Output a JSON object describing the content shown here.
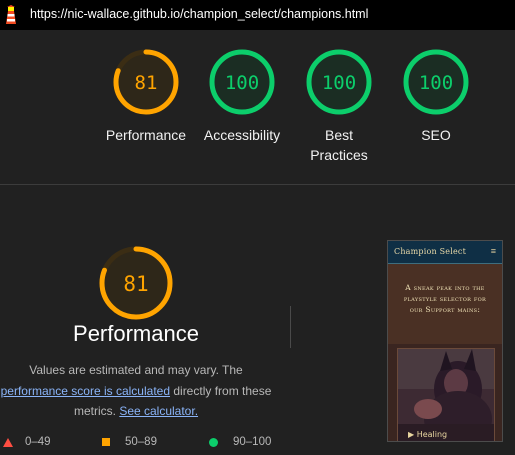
{
  "browser": {
    "url": "https://nic-wallace.github.io/champion_select/champions.html",
    "logo_icon": "lighthouse-icon"
  },
  "summary": {
    "gauges": [
      {
        "label": "Performance",
        "score": "81",
        "value": 81,
        "color": "#ffa400",
        "track": "#3b2d14",
        "text_color": "#ffa400"
      },
      {
        "label": "Accessibility",
        "score": "100",
        "value": 100,
        "color": "#0cce6b",
        "track": "#173826",
        "text_color": "#0cce6b"
      },
      {
        "label": "Best Practices",
        "score": "100",
        "value": 100,
        "color": "#0cce6b",
        "track": "#173826",
        "text_color": "#0cce6b"
      },
      {
        "label": "SEO",
        "score": "100",
        "value": 100,
        "color": "#0cce6b",
        "track": "#173826",
        "text_color": "#0cce6b"
      }
    ]
  },
  "performance": {
    "score": "81",
    "value": 81,
    "title": "Performance",
    "desc_line1": "Values are estimated and may vary. The",
    "desc_link": "performance score is calculated",
    "desc_line2_after": " directly from these",
    "desc_line3_before": "metrics. ",
    "calc_link": "See calculator.",
    "colors": {
      "average": "#ffa400",
      "pass": "#0cce6b",
      "fail": "#ff4e42"
    }
  },
  "legend": [
    {
      "range": "0–49",
      "icon": "fail-triangle-icon"
    },
    {
      "range": "50–89",
      "icon": "average-square-icon"
    },
    {
      "range": "90–100",
      "icon": "pass-circle-icon"
    }
  ],
  "screenshot": {
    "title": "Champion Select",
    "caption": "A sneak peak into the playstyle selector for our Support mains:",
    "art_label": "▶ Healing",
    "menu_icon": "menu-icon"
  }
}
